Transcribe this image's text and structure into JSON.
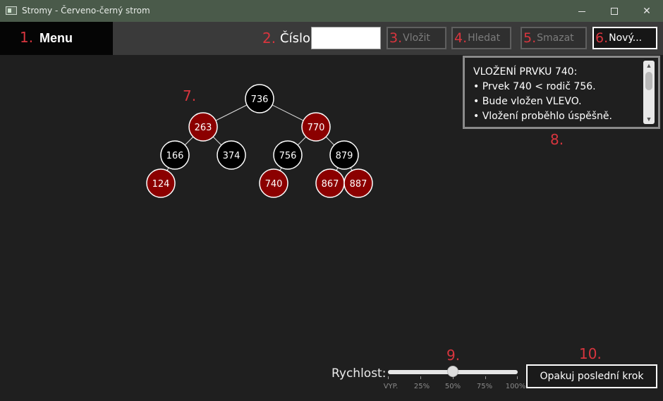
{
  "window": {
    "title": "Stromy - Červeno-černý strom",
    "minimize_glyph": "minimize-icon",
    "maximize_glyph": "maximize-icon",
    "close_glyph": "✕"
  },
  "annotations": {
    "n1": "1.",
    "n2": "2.",
    "n3": "3.",
    "n4": "4.",
    "n5": "5.",
    "n6": "6.",
    "n7": "7.",
    "n8": "8.",
    "n9": "9.",
    "n10": "10."
  },
  "toolbar": {
    "menu_label": "Menu",
    "number_label": "Číslo:",
    "number_value": "",
    "insert_label": "Vložit",
    "search_label": "Hledat",
    "delete_label": "Smazat",
    "new_label": "Nový..."
  },
  "info_panel": {
    "lines": [
      "VLOŽENÍ PRVKU 740:",
      " • Prvek 740 < rodič 756.",
      " • Bude vložen VLEVO.",
      " • Vložení proběhlo úspěšně."
    ],
    "scroll_up_icon": "▲",
    "scroll_down_icon": "▼"
  },
  "tree": {
    "node_colors": {
      "black": "#000000",
      "red": "#8b0000",
      "stroke": "#ffffff"
    },
    "nodes": [
      {
        "id": "n736",
        "value": "736",
        "color": "black",
        "depth": 0,
        "slot": 0
      },
      {
        "id": "n263",
        "value": "263",
        "color": "red",
        "depth": 1,
        "slot": 0
      },
      {
        "id": "n770",
        "value": "770",
        "color": "red",
        "depth": 1,
        "slot": 1
      },
      {
        "id": "n166",
        "value": "166",
        "color": "black",
        "depth": 2,
        "slot": 0
      },
      {
        "id": "n374",
        "value": "374",
        "color": "black",
        "depth": 2,
        "slot": 1
      },
      {
        "id": "n756",
        "value": "756",
        "color": "black",
        "depth": 2,
        "slot": 2
      },
      {
        "id": "n879",
        "value": "879",
        "color": "black",
        "depth": 2,
        "slot": 3
      },
      {
        "id": "n124",
        "value": "124",
        "color": "red",
        "depth": 3,
        "slot": 0
      },
      {
        "id": "n740",
        "value": "740",
        "color": "red",
        "depth": 3,
        "slot": 4
      },
      {
        "id": "n867",
        "value": "867",
        "color": "red",
        "depth": 3,
        "slot": 6
      },
      {
        "id": "n887",
        "value": "887",
        "color": "red",
        "depth": 3,
        "slot": 7
      }
    ],
    "edges": [
      [
        "n736",
        "n263"
      ],
      [
        "n736",
        "n770"
      ],
      [
        "n263",
        "n166"
      ],
      [
        "n263",
        "n374"
      ],
      [
        "n770",
        "n756"
      ],
      [
        "n770",
        "n879"
      ],
      [
        "n166",
        "n124"
      ],
      [
        "n756",
        "n740"
      ],
      [
        "n879",
        "n867"
      ],
      [
        "n879",
        "n887"
      ]
    ]
  },
  "speed": {
    "label": "Rychlost:",
    "value_percent": 50,
    "tick_labels": [
      "VYP.",
      "25%",
      "50%",
      "75%",
      "100%"
    ]
  },
  "repeat_button_label": "Opakuj poslední krok"
}
